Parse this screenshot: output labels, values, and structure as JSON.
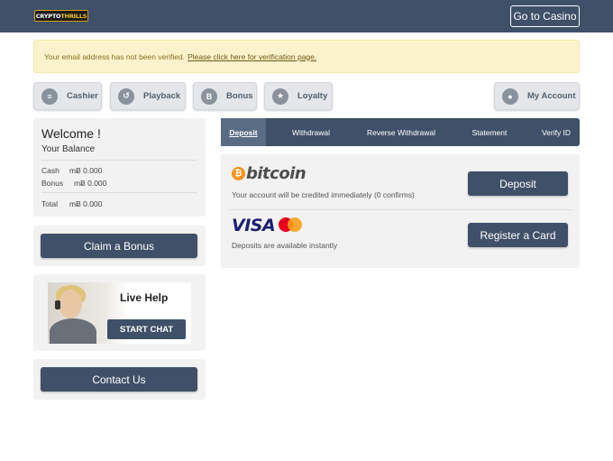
{
  "header": {
    "logo_text_a": "CRYPTO",
    "logo_text_b": "THRILLS",
    "go_casino_label": "Go to Casino"
  },
  "alert": {
    "message": "Your email address has not been verified.",
    "link_text": "Please click here for verification page."
  },
  "nav": {
    "cashier": "Cashier",
    "playback": "Playback",
    "bonus": "Bonus",
    "loyalty": "Loyalty",
    "my_account": "My Account"
  },
  "welcome": {
    "title": "Welcome !",
    "balance_label": "Your Balance",
    "cash_label": "Cash",
    "cash_value": "mɃ 0.000",
    "bonus_label": "Bonus",
    "bonus_value": "mɃ 0.000",
    "total_label": "Total",
    "total_value": "mɃ 0.000"
  },
  "claim_bonus_label": "Claim a Bonus",
  "live_help": {
    "title": "Live Help",
    "button": "START CHAT"
  },
  "contact_label": "Contact Us",
  "tabs": [
    {
      "label": "Deposit",
      "active": true
    },
    {
      "label": "Withdrawal",
      "active": false
    },
    {
      "label": "Reverse Withdrawal",
      "active": false
    },
    {
      "label": "Statement",
      "active": false
    },
    {
      "label": "Verify ID",
      "active": false
    }
  ],
  "payments": {
    "bitcoin_symbol": "₿",
    "bitcoin_brand": "bitcoin",
    "bitcoin_note": "Your account will be credited immediately (0 confirms)",
    "deposit_label": "Deposit",
    "visa_brand": "VISA",
    "card_note": "Deposits are available instantly",
    "register_label": "Register a Card"
  },
  "colors": {
    "header_bg": "#3f5068",
    "alert_bg": "#fcf3cc",
    "button_dark": "#3f5068",
    "bitcoin_orange": "#f7931a"
  },
  "icons": {
    "cashier": "coins-icon",
    "playback": "playback-icon",
    "bonus": "bonus-icon",
    "loyalty": "loyalty-star-icon",
    "my_account": "user-icon"
  }
}
